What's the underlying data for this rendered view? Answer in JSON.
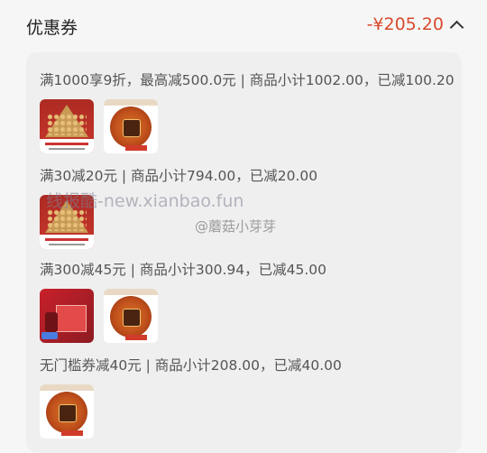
{
  "header": {
    "title": "优惠券",
    "amount": "-¥205.20",
    "chevron_icon": "chevron-up-icon"
  },
  "coupons": [
    {
      "rule": "满1000享9折，最高减500.0元 | 商品小计1002.00，已减100.20",
      "items": [
        "tower-gift-box",
        "round-tea-tin"
      ]
    },
    {
      "rule": "满30减20元 | 商品小计794.00，已减20.00",
      "items": [
        "tower-gift-box"
      ]
    },
    {
      "rule": "满300减45元 | 商品小计300.94，已减45.00",
      "items": [
        "red-gift-set",
        "round-tea-tin"
      ]
    },
    {
      "rule": "无门槛券减40元 | 商品小计208.00，已减40.00",
      "items": [
        "round-tea-tin"
      ]
    }
  ],
  "watermarks": {
    "site": "线报酷-new.xianbao.fun",
    "weibo": "@蘑菇小芽芽"
  },
  "colors": {
    "accent": "#d84a2e",
    "card_bg": "#efefef",
    "page_bg": "#f6f6f6"
  }
}
